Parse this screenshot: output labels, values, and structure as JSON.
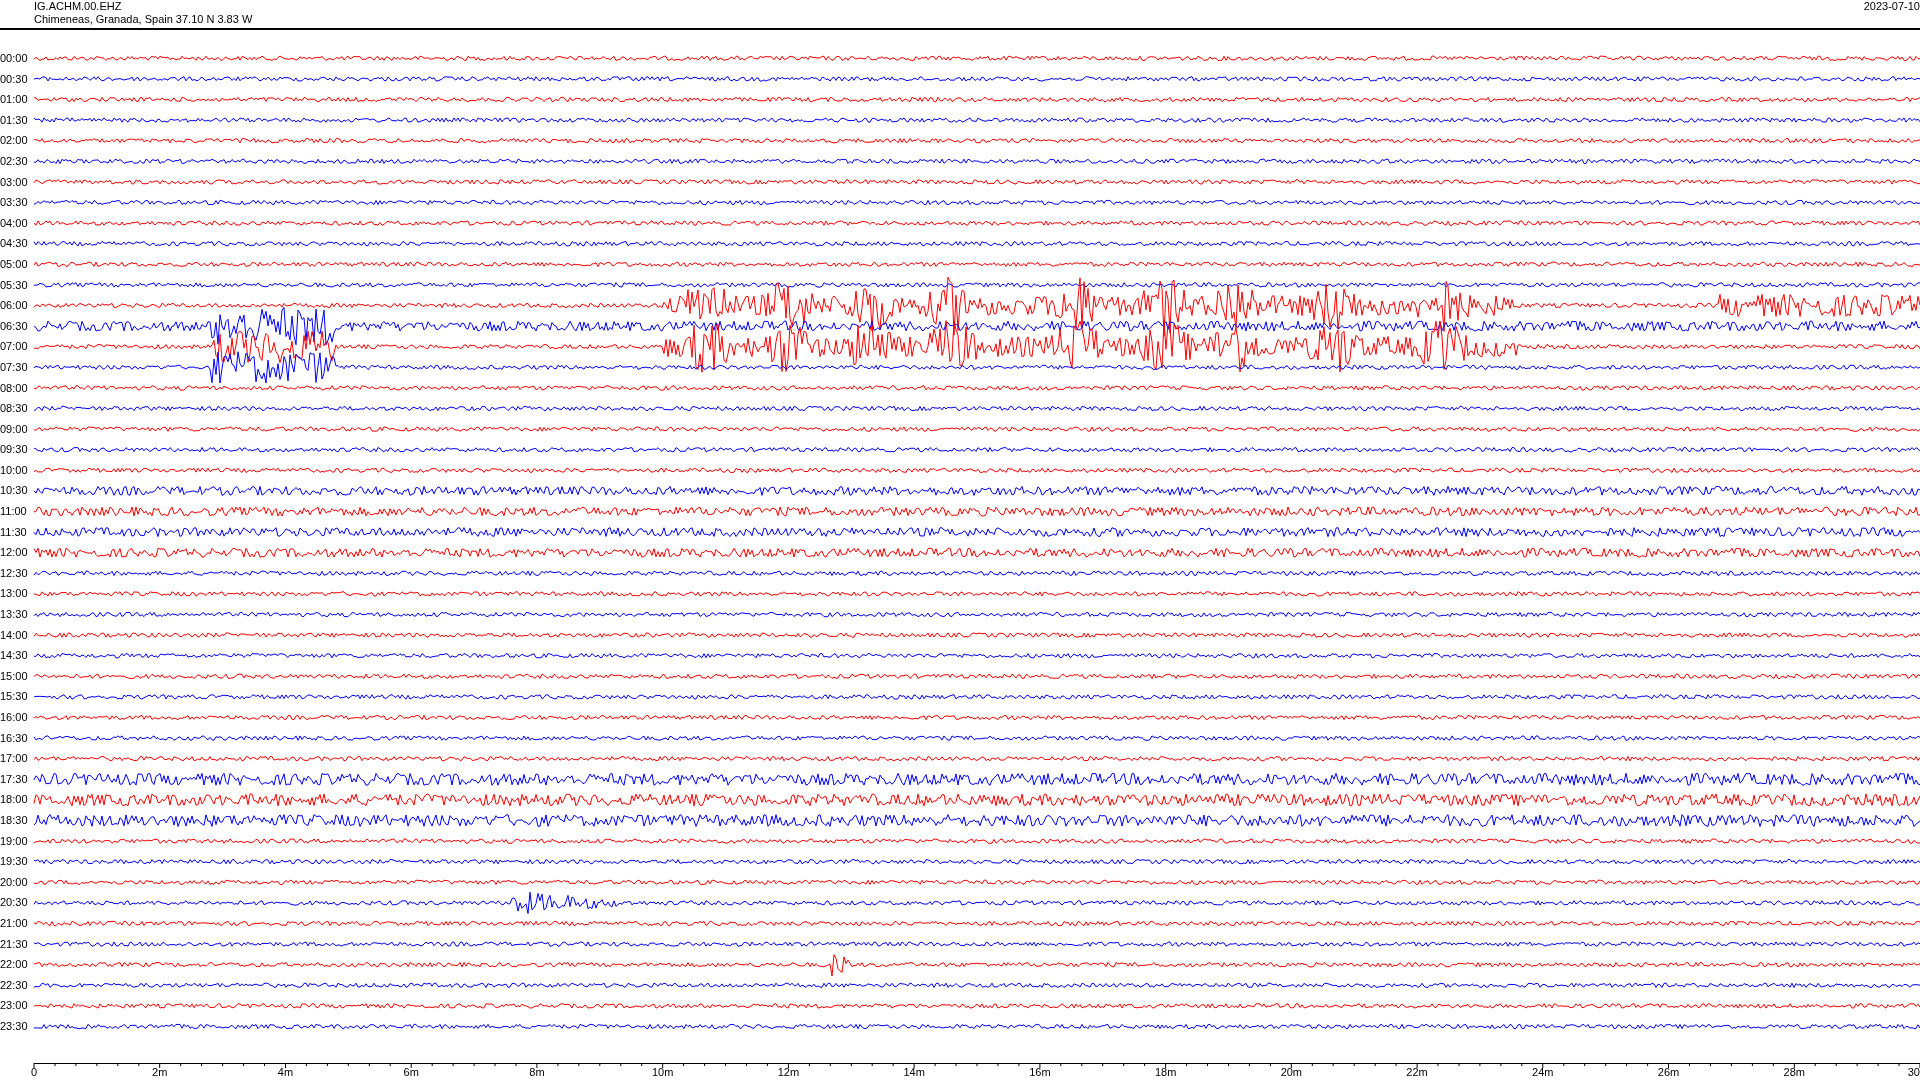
{
  "header": {
    "station": "IG.ACHM.00.EHZ",
    "location": "Chimeneas, Granada, Spain  37.10 N 3.83 W",
    "date": "2023-07-10"
  },
  "rows": [
    {
      "label": "00:00",
      "color": "#ff0000"
    },
    {
      "label": "00:30",
      "color": "#0000ff"
    },
    {
      "label": "01:00",
      "color": "#ff0000"
    },
    {
      "label": "01:30",
      "color": "#0000ff"
    },
    {
      "label": "02:00",
      "color": "#ff0000"
    },
    {
      "label": "02:30",
      "color": "#0000ff"
    },
    {
      "label": "03:00",
      "color": "#ff0000"
    },
    {
      "label": "03:30",
      "color": "#0000ff"
    },
    {
      "label": "04:00",
      "color": "#ff0000"
    },
    {
      "label": "04:30",
      "color": "#0000ff"
    },
    {
      "label": "05:00",
      "color": "#ff0000"
    },
    {
      "label": "05:30",
      "color": "#0000ff"
    },
    {
      "label": "06:00",
      "color": "#ff0000"
    },
    {
      "label": "06:30",
      "color": "#0000ff"
    },
    {
      "label": "07:00",
      "color": "#ff0000"
    },
    {
      "label": "07:30",
      "color": "#0000ff"
    },
    {
      "label": "08:00",
      "color": "#ff0000"
    },
    {
      "label": "08:30",
      "color": "#0000ff"
    },
    {
      "label": "09:00",
      "color": "#ff0000"
    },
    {
      "label": "09:30",
      "color": "#0000ff"
    },
    {
      "label": "10:00",
      "color": "#ff0000"
    },
    {
      "label": "10:30",
      "color": "#0000ff"
    },
    {
      "label": "11:00",
      "color": "#ff0000"
    },
    {
      "label": "11:30",
      "color": "#0000ff"
    },
    {
      "label": "12:00",
      "color": "#ff0000"
    },
    {
      "label": "12:30",
      "color": "#0000ff"
    },
    {
      "label": "13:00",
      "color": "#ff0000"
    },
    {
      "label": "13:30",
      "color": "#0000ff"
    },
    {
      "label": "14:00",
      "color": "#ff0000"
    },
    {
      "label": "14:30",
      "color": "#0000ff"
    },
    {
      "label": "15:00",
      "color": "#ff0000"
    },
    {
      "label": "15:30",
      "color": "#0000ff"
    },
    {
      "label": "16:00",
      "color": "#ff0000"
    },
    {
      "label": "16:30",
      "color": "#0000ff"
    },
    {
      "label": "17:00",
      "color": "#ff0000"
    },
    {
      "label": "17:30",
      "color": "#0000ff"
    },
    {
      "label": "18:00",
      "color": "#ff0000"
    },
    {
      "label": "18:30",
      "color": "#0000ff"
    },
    {
      "label": "19:00",
      "color": "#ff0000"
    },
    {
      "label": "19:30",
      "color": "#0000ff"
    },
    {
      "label": "20:00",
      "color": "#ff0000"
    },
    {
      "label": "20:30",
      "color": "#0000ff"
    },
    {
      "label": "21:00",
      "color": "#ff0000"
    },
    {
      "label": "21:30",
      "color": "#0000ff"
    },
    {
      "label": "22:00",
      "color": "#ff0000"
    },
    {
      "label": "22:30",
      "color": "#0000ff"
    },
    {
      "label": "23:00",
      "color": "#ff0000"
    },
    {
      "label": "23:30",
      "color": "#0000ff"
    }
  ],
  "x_axis": {
    "ticks": [
      "0",
      "2m",
      "4m",
      "6m",
      "8m",
      "10m",
      "12m",
      "14m",
      "16m",
      "18m",
      "20m",
      "22m",
      "24m",
      "26m",
      "28m",
      "30"
    ]
  }
}
